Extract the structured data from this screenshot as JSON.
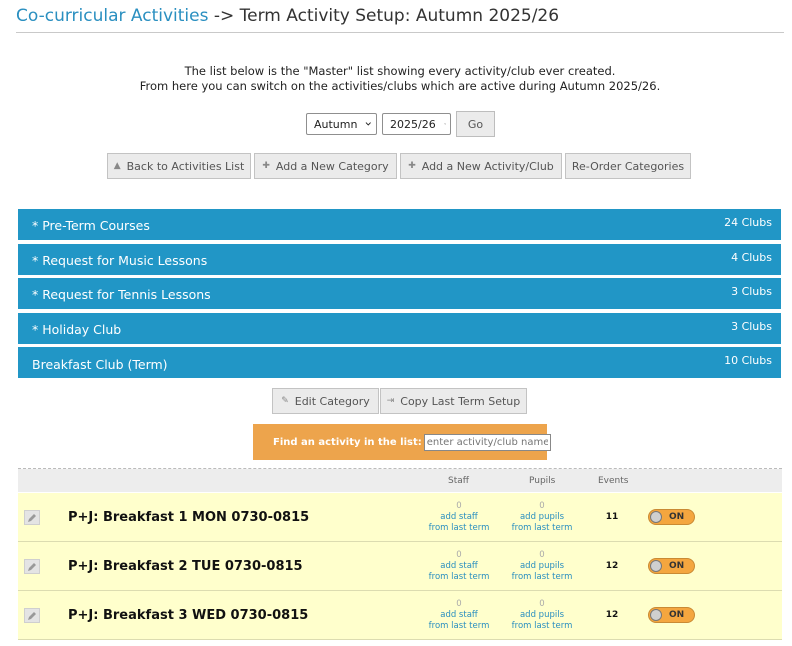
{
  "header": {
    "crumb": "Co-curricular Activities",
    "separator": " -> ",
    "title": "Term Activity Setup: Autumn 2025/26"
  },
  "intro": {
    "line1": "The list below is the \"Master\" list showing every activity/club ever created.",
    "line2": "From here you can switch on the activities/clubs which are active during Autumn 2025/26."
  },
  "filters": {
    "term": "Autumn",
    "year": "2025/26",
    "go_label": "Go"
  },
  "toolbar": {
    "back_label": "Back to Activities List",
    "add_category_label": "Add a New Category",
    "add_activity_label": "Add a New Activity/Club",
    "reorder_label": "Re-Order Categories"
  },
  "categories": [
    {
      "name": "* Pre-Term Courses",
      "count": "24 Clubs"
    },
    {
      "name": "* Request for Music Lessons",
      "count": "4 Clubs"
    },
    {
      "name": "* Request for Tennis Lessons",
      "count": "3 Clubs"
    },
    {
      "name": "* Holiday Club",
      "count": "3 Clubs"
    },
    {
      "name": "Breakfast Club (Term)",
      "count": "10 Clubs"
    }
  ],
  "category_actions": {
    "edit_label": "Edit Category",
    "copy_label": "Copy Last Term Setup"
  },
  "search": {
    "label": "Find an activity in the list:",
    "placeholder": "enter activity/club name"
  },
  "table": {
    "col_staff": "Staff",
    "col_pupils": "Pupils",
    "col_events": "Events",
    "rows": [
      {
        "name": "P+J: Breakfast 1 MON 0730-0815",
        "staff_count": "0",
        "staff_add": "add staff",
        "staff_from": "from last term",
        "pupils_count": "0",
        "pupils_add": "add pupils",
        "pupils_from": "from last term",
        "events": "11",
        "toggle": "ON"
      },
      {
        "name": "P+J: Breakfast 2 TUE 0730-0815",
        "staff_count": "0",
        "staff_add": "add staff",
        "staff_from": "from last term",
        "pupils_count": "0",
        "pupils_add": "add pupils",
        "pupils_from": "from last term",
        "events": "12",
        "toggle": "ON"
      },
      {
        "name": "P+J: Breakfast 3 WED 0730-0815",
        "staff_count": "0",
        "staff_add": "add staff",
        "staff_from": "from last term",
        "pupils_count": "0",
        "pupils_add": "add pupils",
        "pupils_from": "from last term",
        "events": "12",
        "toggle": "ON"
      }
    ]
  },
  "colors": {
    "accent_blue": "#2196c6",
    "link_blue": "#2a8fc0",
    "search_orange": "#eda44c",
    "row_yellow": "#ffffcc",
    "toggle_orange": "#f4a63f"
  },
  "icons": {
    "back": "caret-up-icon",
    "add": "plus-icon",
    "edit": "pencil-icon",
    "copy": "copy-arrow-icon",
    "select": "chevron-down-icon"
  }
}
